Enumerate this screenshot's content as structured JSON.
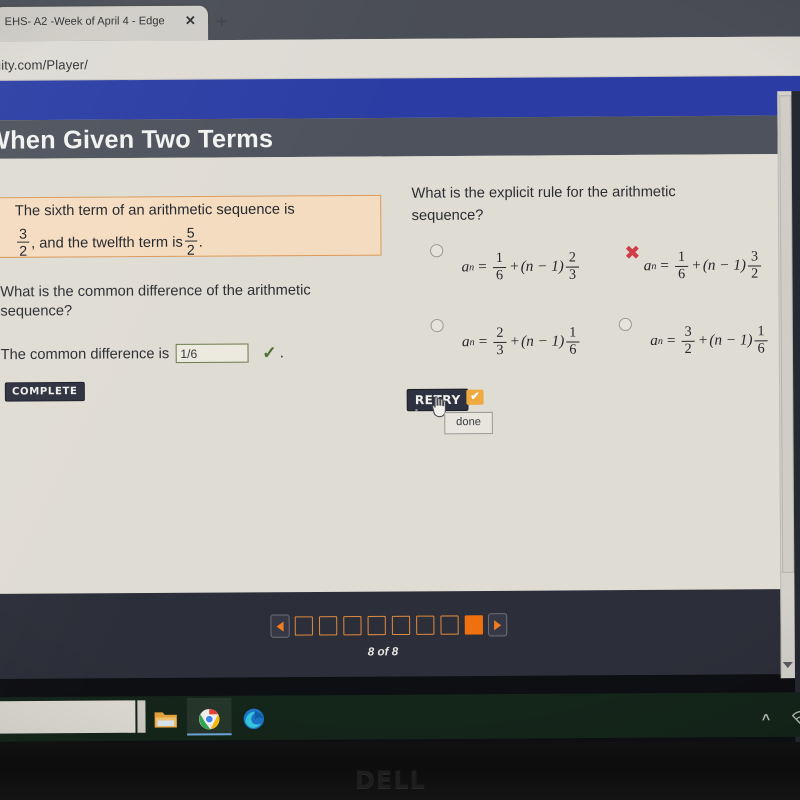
{
  "browser": {
    "tab_title": "EHS- A2 -Week of April 4 - Edge",
    "tab_close_icon": "close-icon",
    "new_tab_icon": "plus-icon",
    "url": "uity.com/Player/"
  },
  "page": {
    "title": "When Given Two Terms"
  },
  "prompt": {
    "line1": "The sixth term of an arithmetic sequence is",
    "frac1_num": "3",
    "frac1_den": "2",
    "mid": ", and the twelfth term is",
    "frac2_num": "5",
    "frac2_den": "2",
    "end": "."
  },
  "left_question": {
    "text": "What is the common difference of the arithmetic sequence?",
    "answer_label": "The common difference is",
    "answer_value": "1/6",
    "answer_placeholder": "",
    "correct_mark": "✓",
    "trailing_period": ".",
    "complete_button": "COMPLETE"
  },
  "right_question": {
    "text": "What is the explicit rule for the arithmetic sequence?",
    "wrong_mark": "✖",
    "retry_button": "RETRY",
    "retry_badge_icon": "check-badge-icon",
    "tooltip": "done",
    "options": [
      {
        "id": "option-a",
        "lhs": "a",
        "sub": "n",
        "eq": "=",
        "first_num": "1",
        "first_den": "6",
        "plus": "+",
        "paren": "(n − 1)",
        "second_num": "2",
        "second_den": "3",
        "selected": false,
        "marked_wrong": false
      },
      {
        "id": "option-b",
        "lhs": "a",
        "sub": "n",
        "eq": "=",
        "first_num": "1",
        "first_den": "6",
        "plus": "+",
        "paren": "(n − 1)",
        "second_num": "3",
        "second_den": "2",
        "selected": false,
        "marked_wrong": true
      },
      {
        "id": "option-c",
        "lhs": "a",
        "sub": "n",
        "eq": "=",
        "first_num": "2",
        "first_den": "3",
        "plus": "+",
        "paren": "(n − 1)",
        "second_num": "1",
        "second_den": "6",
        "selected": false,
        "marked_wrong": false
      },
      {
        "id": "option-d",
        "lhs": "a",
        "sub": "n",
        "eq": "=",
        "first_num": "3",
        "first_den": "2",
        "plus": "+",
        "paren": "(n − 1)",
        "second_num": "1",
        "second_den": "6",
        "selected": false,
        "marked_wrong": false
      }
    ]
  },
  "pager": {
    "prev_icon": "triangle-left-icon",
    "next_icon": "triangle-right-icon",
    "label": "8 of 8",
    "total": 8,
    "current": 8
  },
  "taskbar": {
    "items": [
      {
        "icon": "file-explorer-icon",
        "label": "File Explorer"
      },
      {
        "icon": "chrome-icon",
        "label": "Google Chrome"
      },
      {
        "icon": "edge-icon",
        "label": "Microsoft Edge"
      }
    ],
    "tray_chevron_icon": "chevron-up-icon",
    "tray_network_icon": "wifi-icon"
  },
  "device": {
    "brand": "DELL"
  },
  "colors": {
    "blue_band": "#2b3da4",
    "title_bar": "#4e525c",
    "prompt_bg": "#f4dcc0",
    "prompt_border": "#d99a5c",
    "accent_orange": "#f0700f",
    "correct_green": "#4e7030",
    "wrong_red": "#cf3b47",
    "button_dark": "#2e3140",
    "badge_orange": "#efa940"
  }
}
